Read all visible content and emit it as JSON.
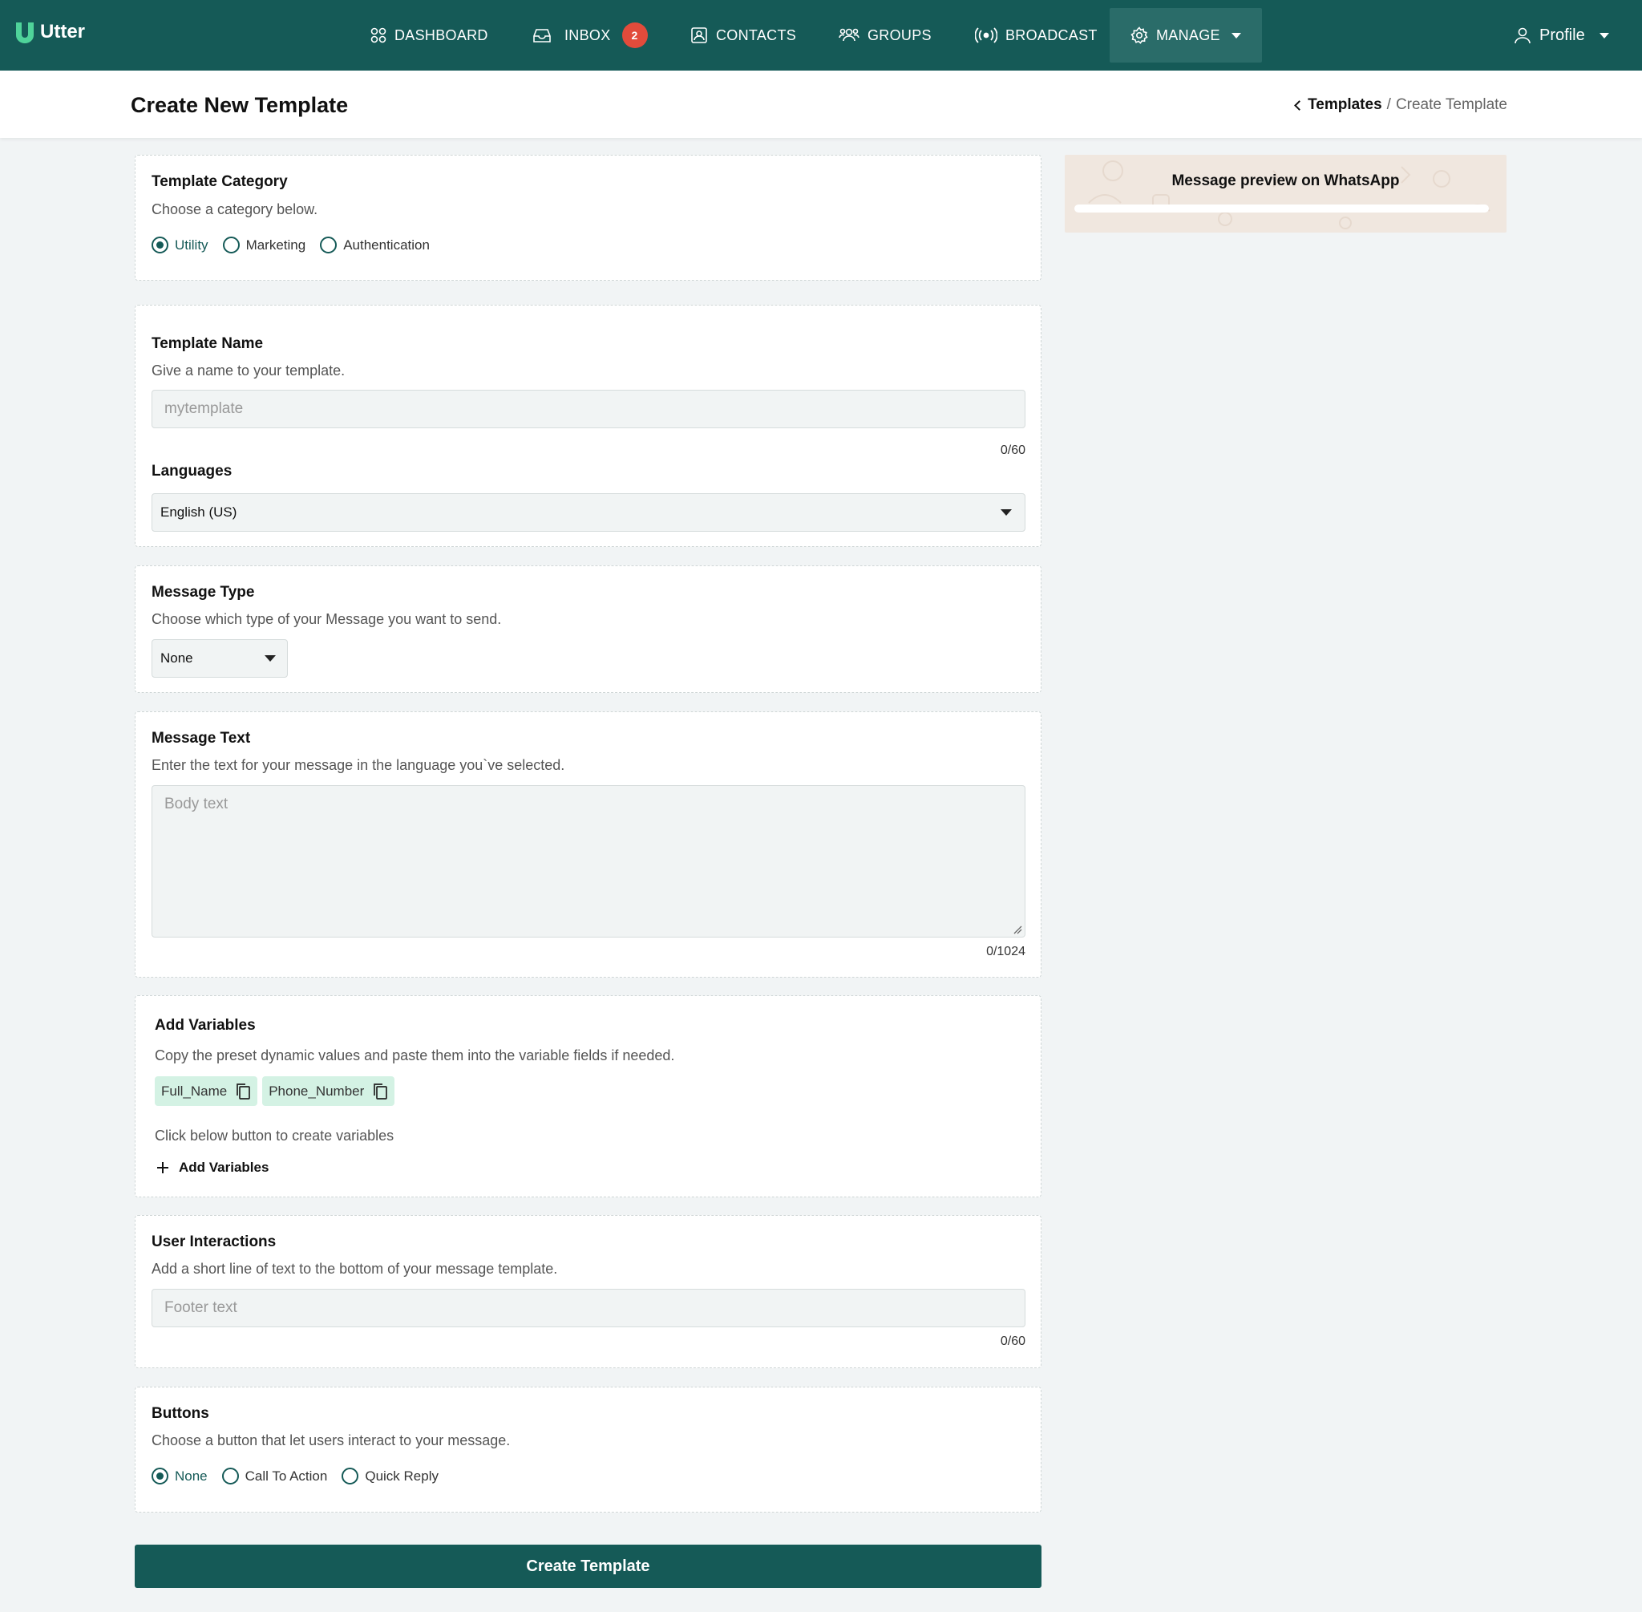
{
  "brand": {
    "name": "Utter"
  },
  "nav": {
    "dashboard": "DASHBOARD",
    "inbox": "INBOX",
    "inbox_badge": "2",
    "contacts": "CONTACTS",
    "groups": "GROUPS",
    "broadcast": "BROADCAST",
    "manage": "MANAGE",
    "profile": "Profile"
  },
  "header": {
    "title": "Create New Template",
    "breadcrumb_parent": "Templates",
    "breadcrumb_sep": "/",
    "breadcrumb_current": "Create Template"
  },
  "category": {
    "title": "Template Category",
    "subtitle": "Choose a category below.",
    "options": [
      "Utility",
      "Marketing",
      "Authentication"
    ],
    "selected": "Utility"
  },
  "template_name": {
    "title": "Template Name",
    "subtitle": "Give a name to your template.",
    "placeholder": "mytemplate",
    "value": "",
    "counter": "0/60",
    "languages_label": "Languages",
    "language_value": "English (US)"
  },
  "message_type": {
    "title": "Message Type",
    "subtitle": "Choose which type of your Message you want to send.",
    "value": "None"
  },
  "message_text": {
    "title": "Message Text",
    "subtitle": "Enter the text for your message in the language you`ve selected.",
    "placeholder": "Body text",
    "counter": "0/1024"
  },
  "variables": {
    "title": "Add Variables",
    "subtitle": "Copy the preset dynamic values and paste them into the variable fields if needed.",
    "chips": [
      "Full_Name",
      "Phone_Number"
    ],
    "hint": "Click below button to create variables",
    "add_label": "Add Variables"
  },
  "user_interactions": {
    "title": "User Interactions",
    "subtitle": "Add a short line of text to the bottom of your message template.",
    "placeholder": "Footer text",
    "counter": "0/60"
  },
  "buttons": {
    "title": "Buttons",
    "subtitle": "Choose a button that let users interact to your message.",
    "options": [
      "None",
      "Call To Action",
      "Quick Reply"
    ],
    "selected": "None"
  },
  "preview": {
    "title": "Message preview on WhatsApp"
  },
  "submit": {
    "label": "Create Template"
  },
  "colors": {
    "primary": "#155a57",
    "badge": "#e24b3b",
    "chip": "#d4f2e4",
    "preview_bg": "#f0e7df"
  }
}
